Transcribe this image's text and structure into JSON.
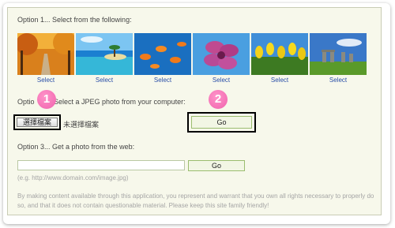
{
  "option1": {
    "heading": "Option 1... Select from the following:",
    "photos": [
      {
        "icon": "autumn-road-thumbnail",
        "select_label": "Select"
      },
      {
        "icon": "beach-island-thumbnail",
        "select_label": "Select"
      },
      {
        "icon": "goldfish-thumbnail",
        "select_label": "Select"
      },
      {
        "icon": "pink-flower-thumbnail",
        "select_label": "Select"
      },
      {
        "icon": "tulips-thumbnail",
        "select_label": "Select"
      },
      {
        "icon": "stonehenge-thumbnail",
        "select_label": "Select"
      }
    ]
  },
  "option2": {
    "heading_prefix": "Optio",
    "heading_suffix": "Select a JPEG photo from your computer:",
    "choose_file_label": "選擇檔案",
    "no_file_text": "未選擇檔案",
    "go_label": "Go",
    "badge_1": "1",
    "badge_2": "2"
  },
  "option3": {
    "heading": "Option 3... Get a photo from the web:",
    "url_value": "",
    "go_label": "Go",
    "url_example": "(e.g. http://www.domain.com/image.jpg)"
  },
  "disclaimer": "By making content available through this application, you represent and warrant that you own all rights necessary to properly do so, and that it does not contain questionable material. Please keep this site family friendly!",
  "colors": {
    "panel_bg": "#f7f8eb",
    "link": "#2a4fa8",
    "badge": "#f062ad",
    "highlight_border": "#000000"
  }
}
